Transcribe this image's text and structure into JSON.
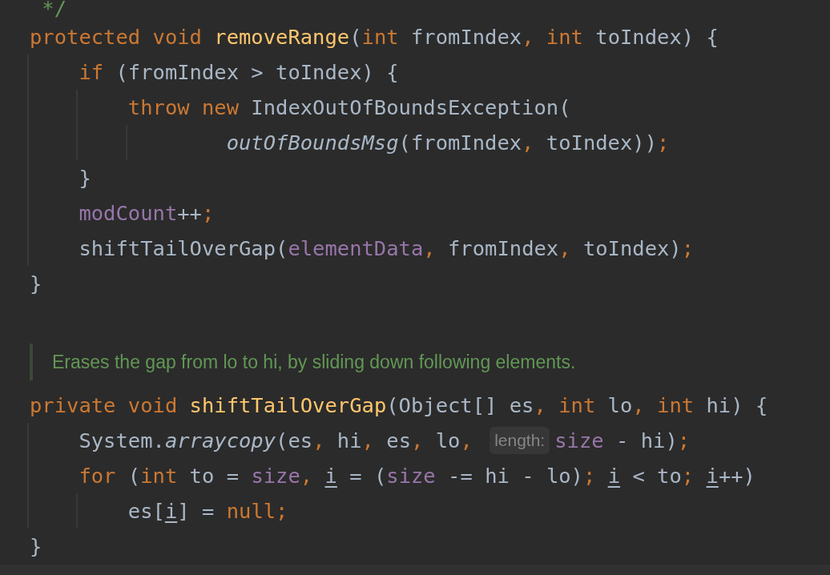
{
  "editor": {
    "lines": [
      {
        "kind": "code",
        "segments": [
          {
            "kind": "code",
            "tokens": [
              {
                "t": " */",
                "kind": "comment"
              }
            ]
          }
        ]
      },
      {
        "kind": "code",
        "segments": [
          {
            "kind": "code",
            "tokens": [
              {
                "t": "protected void ",
                "kind": "kw"
              },
              {
                "t": "removeRange",
                "kind": "fn"
              },
              {
                "t": "(",
                "kind": "plain"
              },
              {
                "t": "int ",
                "kind": "kw"
              },
              {
                "t": "fromIndex",
                "kind": "plain"
              },
              {
                "t": ", ",
                "kind": "punct"
              },
              {
                "t": "int ",
                "kind": "kw"
              },
              {
                "t": "toIndex) {",
                "kind": "plain"
              }
            ]
          }
        ]
      },
      {
        "kind": "code",
        "segments": [
          {
            "kind": "code",
            "tokens": [
              {
                "t": "    if ",
                "kind": "kw"
              },
              {
                "t": "(fromIndex > toIndex) {",
                "kind": "plain"
              }
            ]
          }
        ]
      },
      {
        "kind": "code",
        "segments": [
          {
            "kind": "code",
            "tokens": [
              {
                "t": "        throw new ",
                "kind": "kw"
              },
              {
                "t": "IndexOutOfBoundsException(",
                "kind": "plain"
              }
            ]
          }
        ]
      },
      {
        "kind": "code",
        "segments": [
          {
            "kind": "code",
            "tokens": [
              {
                "t": "                outOfBoundsMsg",
                "kind": "static"
              },
              {
                "t": "(fromIndex",
                "kind": "plain"
              },
              {
                "t": ", ",
                "kind": "punct"
              },
              {
                "t": "toIndex))",
                "kind": "plain"
              },
              {
                "t": ";",
                "kind": "punct"
              }
            ]
          }
        ]
      },
      {
        "kind": "code",
        "segments": [
          {
            "kind": "code",
            "tokens": [
              {
                "t": "    }",
                "kind": "plain"
              }
            ]
          }
        ]
      },
      {
        "kind": "code",
        "segments": [
          {
            "kind": "code",
            "tokens": [
              {
                "t": "    modCount",
                "kind": "field"
              },
              {
                "t": "++",
                "kind": "plain"
              },
              {
                "t": ";",
                "kind": "punct"
              }
            ]
          }
        ]
      },
      {
        "kind": "code",
        "segments": [
          {
            "kind": "code",
            "tokens": [
              {
                "t": "    shiftTailOverGap(",
                "kind": "plain"
              },
              {
                "t": "elementData",
                "kind": "field"
              },
              {
                "t": ", ",
                "kind": "punct"
              },
              {
                "t": "fromIndex",
                "kind": "plain"
              },
              {
                "t": ", ",
                "kind": "punct"
              },
              {
                "t": "toIndex)",
                "kind": "plain"
              },
              {
                "t": ";",
                "kind": "punct"
              }
            ]
          }
        ]
      },
      {
        "kind": "code",
        "segments": [
          {
            "kind": "code",
            "tokens": [
              {
                "t": "}",
                "kind": "plain"
              }
            ]
          }
        ]
      },
      {
        "kind": "blank"
      },
      {
        "kind": "doc",
        "text": "Erases the gap from lo to hi, by sliding down following elements."
      },
      {
        "kind": "code",
        "segments": [
          {
            "kind": "code",
            "tokens": [
              {
                "t": "private void ",
                "kind": "kw"
              },
              {
                "t": "shiftTailOverGap",
                "kind": "fn"
              },
              {
                "t": "(Object[] es",
                "kind": "plain"
              },
              {
                "t": ", ",
                "kind": "punct"
              },
              {
                "t": "int ",
                "kind": "kw"
              },
              {
                "t": "lo",
                "kind": "plain"
              },
              {
                "t": ", ",
                "kind": "punct"
              },
              {
                "t": "int ",
                "kind": "kw"
              },
              {
                "t": "hi) {",
                "kind": "plain"
              }
            ]
          }
        ]
      },
      {
        "kind": "code",
        "segments": [
          {
            "kind": "code",
            "tokens": [
              {
                "t": "    System.",
                "kind": "plain"
              },
              {
                "t": "arraycopy",
                "kind": "static"
              },
              {
                "t": "(es",
                "kind": "plain"
              },
              {
                "t": ", ",
                "kind": "punct"
              },
              {
                "t": "hi",
                "kind": "plain"
              },
              {
                "t": ", ",
                "kind": "punct"
              },
              {
                "t": "es",
                "kind": "plain"
              },
              {
                "t": ", ",
                "kind": "punct"
              },
              {
                "t": "lo",
                "kind": "plain"
              },
              {
                "t": ", ",
                "kind": "punct"
              }
            ]
          },
          {
            "kind": "hint",
            "text": "length:"
          },
          {
            "kind": "code",
            "tokens": [
              {
                "t": "size",
                "kind": "field"
              },
              {
                "t": " - hi)",
                "kind": "plain"
              },
              {
                "t": ";",
                "kind": "punct"
              }
            ]
          }
        ]
      },
      {
        "kind": "code",
        "segments": [
          {
            "kind": "code",
            "tokens": [
              {
                "t": "    for ",
                "kind": "kw"
              },
              {
                "t": "(",
                "kind": "plain"
              },
              {
                "t": "int ",
                "kind": "kw"
              },
              {
                "t": "to = ",
                "kind": "plain"
              },
              {
                "t": "size",
                "kind": "field"
              },
              {
                "t": ", ",
                "kind": "punct"
              },
              {
                "t": "i",
                "kind": "reassigned"
              },
              {
                "t": " = (",
                "kind": "plain"
              },
              {
                "t": "size",
                "kind": "field"
              },
              {
                "t": " -= hi - lo)",
                "kind": "plain"
              },
              {
                "t": "; ",
                "kind": "punct"
              },
              {
                "t": "i",
                "kind": "reassigned"
              },
              {
                "t": " < to",
                "kind": "plain"
              },
              {
                "t": "; ",
                "kind": "punct"
              },
              {
                "t": "i",
                "kind": "reassigned"
              },
              {
                "t": "++)",
                "kind": "plain"
              }
            ]
          }
        ]
      },
      {
        "kind": "code",
        "segments": [
          {
            "kind": "code",
            "tokens": [
              {
                "t": "        es[",
                "kind": "plain"
              },
              {
                "t": "i",
                "kind": "reassigned"
              },
              {
                "t": "] = ",
                "kind": "plain"
              },
              {
                "t": "null",
                "kind": "kw"
              },
              {
                "t": ";",
                "kind": "punct"
              }
            ]
          }
        ]
      },
      {
        "kind": "code",
        "segments": [
          {
            "kind": "code",
            "tokens": [
              {
                "t": "}",
                "kind": "plain"
              }
            ]
          }
        ]
      }
    ]
  }
}
